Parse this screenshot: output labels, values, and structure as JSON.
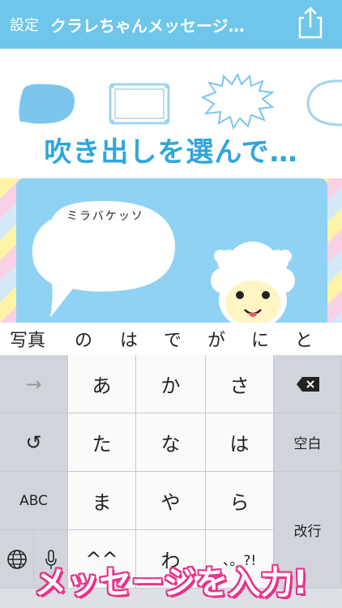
{
  "header": {
    "settings_label": "設定",
    "title": "クラレちゃんメッセージ…",
    "share_icon": "share-icon"
  },
  "picker": {
    "instruction": "吹き出しを選んで…",
    "options": [
      "blue-oval-bubble",
      "framed-rect-bubble",
      "spiky-bubble",
      "outlined-bubble"
    ]
  },
  "preview": {
    "speech_text": "ミラバケッソ",
    "character": "alpaca"
  },
  "predictive": [
    "写真",
    "の",
    "は",
    "で",
    "が",
    "に",
    "と"
  ],
  "keyboard": {
    "row1": [
      "→",
      "あ",
      "か",
      "さ",
      "⌫"
    ],
    "row2": [
      "↺",
      "た",
      "な",
      "は",
      "空白"
    ],
    "row3": [
      "ABC",
      "ま",
      "や",
      "ら",
      "改行"
    ],
    "row4": [
      "🌐",
      "🎤",
      "^^",
      "わ",
      "、。?!"
    ]
  },
  "banner": {
    "text": "メッセージを入力!"
  },
  "colors": {
    "header": "#6ec6ea",
    "accent_blue": "#2da6dd",
    "banner_pink": "#e8338b"
  }
}
